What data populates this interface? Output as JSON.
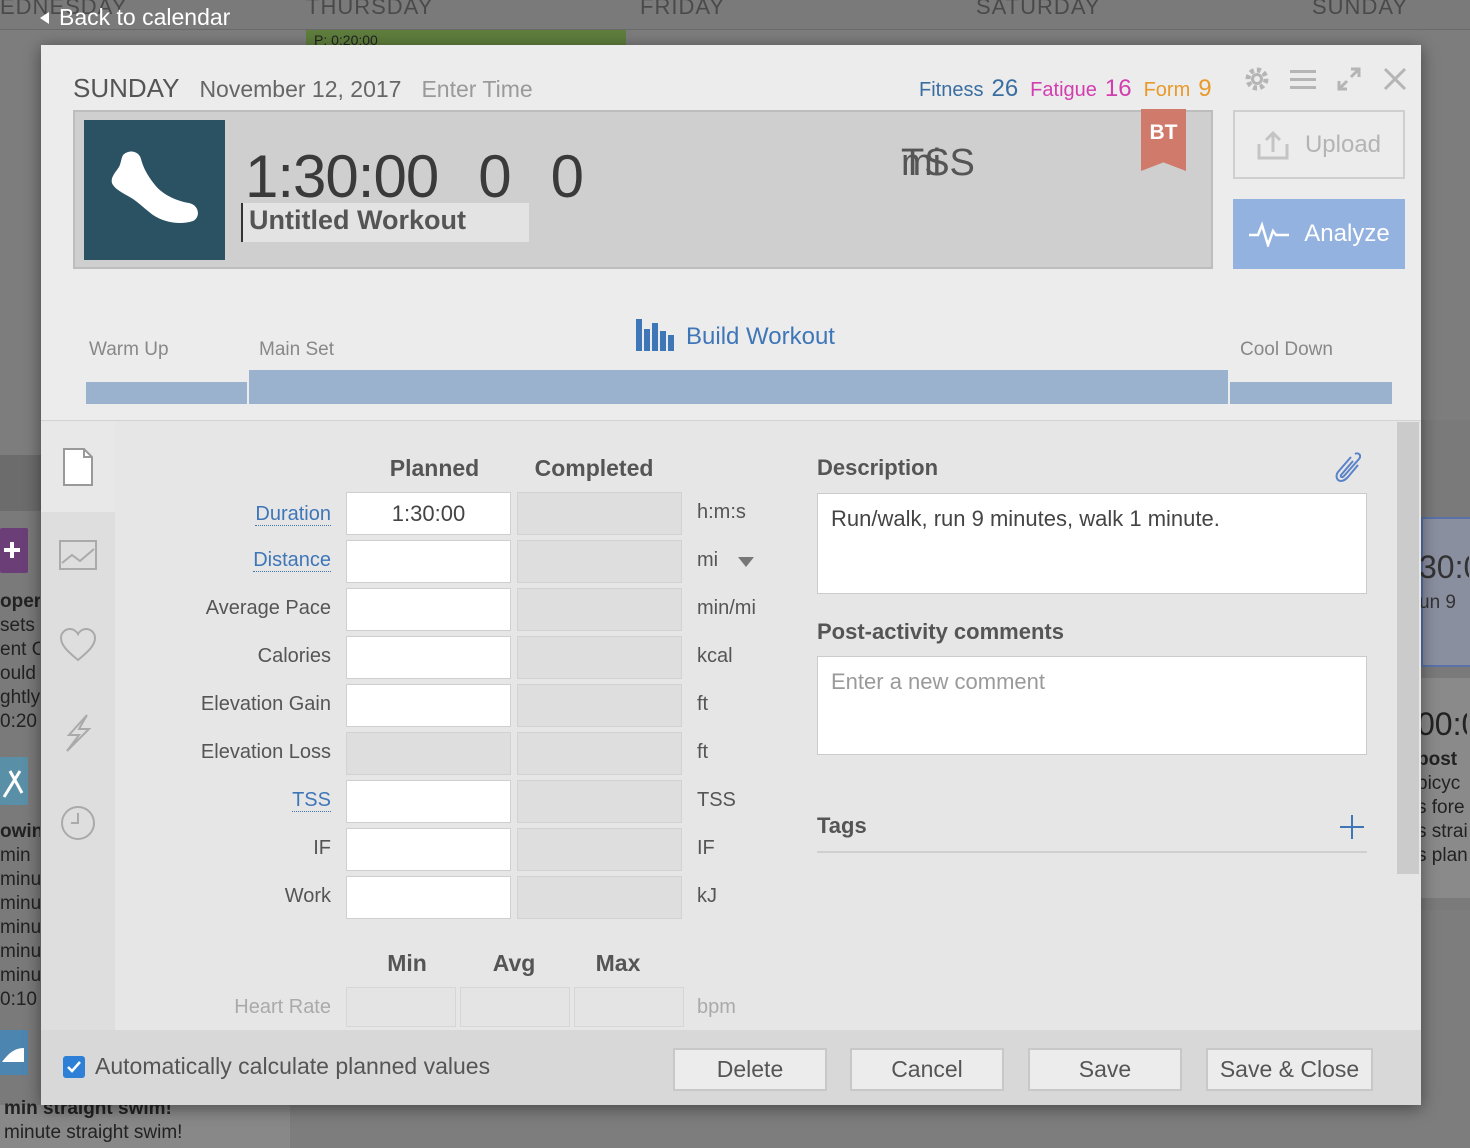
{
  "background": {
    "back_link": "Back to calendar",
    "days": [
      "EDNESDAY",
      "THURSDAY",
      "FRIDAY",
      "SATURDAY",
      "SUNDAY"
    ],
    "green_event": "P: 0:20:00",
    "left_texts": [
      "oper",
      "sets d",
      "ent O",
      "ould",
      "ghtly",
      "0:20",
      "owing",
      "min",
      "minut",
      "minut",
      "minut",
      "minut",
      "minut",
      "0:10",
      "min straight swim!",
      "minute straight swim!"
    ],
    "right_texts": [
      "30:0",
      "un 9",
      "00:0",
      "post",
      "bicyc",
      "s fore",
      "s strai",
      "s plan"
    ]
  },
  "header": {
    "day": "SUNDAY",
    "date": "November 12, 2017",
    "enter_time": "Enter Time",
    "fitness_label": "Fitness",
    "fitness_value": "26",
    "fatigue_label": "Fatigue",
    "fatigue_value": "16",
    "form_label": "Form",
    "form_value": "9"
  },
  "workout": {
    "duration": "1:30:00",
    "distance_value": "0",
    "distance_unit": "mi",
    "tss_value": "0",
    "tss_unit": "TSS",
    "title": "Untitled Workout",
    "badge": "BT",
    "sport_icon": "running-shoe-icon"
  },
  "actions": {
    "upload": "Upload",
    "analyze": "Analyze",
    "build_workout": "Build Workout"
  },
  "segments": {
    "warm_up": "Warm Up",
    "main_set": "Main Set",
    "cool_down": "Cool Down"
  },
  "table": {
    "planned_header": "Planned",
    "completed_header": "Completed",
    "rows": [
      {
        "label": "Duration",
        "planned": "1:30:00",
        "unit": "h:m:s",
        "link": true
      },
      {
        "label": "Distance",
        "planned": "",
        "unit": "mi",
        "link": true
      },
      {
        "label": "Average Pace",
        "planned": "",
        "unit": "min/mi",
        "link": false
      },
      {
        "label": "Calories",
        "planned": "",
        "unit": "kcal",
        "link": false
      },
      {
        "label": "Elevation Gain",
        "planned": "",
        "unit": "ft",
        "link": false
      },
      {
        "label": "Elevation Loss",
        "planned": "",
        "unit": "ft",
        "link": false
      },
      {
        "label": "TSS",
        "planned": "",
        "unit": "TSS",
        "link": true
      },
      {
        "label": "IF",
        "planned": "",
        "unit": "IF",
        "link": false
      },
      {
        "label": "Work",
        "planned": "",
        "unit": "kJ",
        "link": false
      }
    ],
    "min_header": "Min",
    "avg_header": "Avg",
    "max_header": "Max",
    "heart_rate_label": "Heart Rate",
    "heart_rate_unit": "bpm"
  },
  "description": {
    "heading": "Description",
    "text": "Run/walk, run 9 minutes, walk 1 minute."
  },
  "comments": {
    "heading": "Post-activity comments",
    "placeholder": "Enter a new comment"
  },
  "tags": {
    "heading": "Tags"
  },
  "footer": {
    "auto_calc_label": "Automatically calculate planned values",
    "auto_calc_checked": true,
    "delete": "Delete",
    "cancel": "Cancel",
    "save": "Save",
    "save_close": "Save & Close"
  },
  "colors": {
    "sport_tile": "#2a5263",
    "analyze": "#93b2df",
    "link": "#3f76b8",
    "fitness": "#3a6ea0",
    "fatigue": "#d23eb0",
    "form": "#e89a2a",
    "badge": "#d07a6b",
    "segment": "#9ab2cd"
  }
}
